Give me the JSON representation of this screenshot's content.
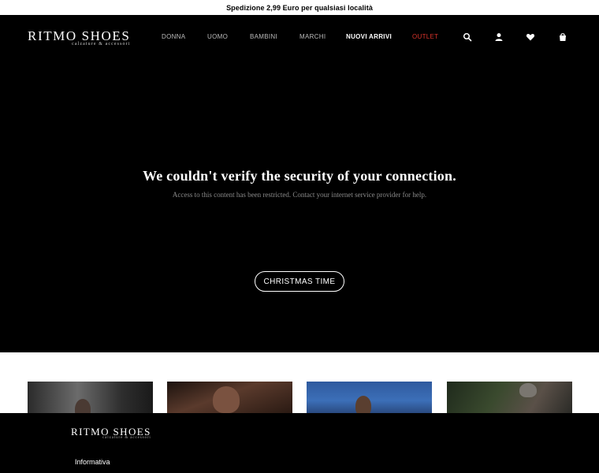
{
  "promo_bar": {
    "text": "Spedizione 2,99 Euro per qualsiasi località"
  },
  "brand": {
    "name": "RITMO SHOES",
    "tagline": "calzature & accessori"
  },
  "nav": {
    "items": [
      {
        "label": "DONNA"
      },
      {
        "label": "UOMO"
      },
      {
        "label": "BAMBINI"
      },
      {
        "label": "MARCHI"
      },
      {
        "label": "NUOVI ARRIVI"
      },
      {
        "label": "OUTLET"
      }
    ],
    "icons": [
      "search-icon",
      "user-icon",
      "heart-icon",
      "bag-icon"
    ]
  },
  "hero": {
    "title": "We couldn't verify the security of your connection.",
    "message": "Access to this content has been restricted. Contact your internet service provider for help.",
    "cta_label": "CHRISTMAS TIME"
  },
  "footer": {
    "brand": "RITMO SHOES",
    "tagline": "calzature & accessori",
    "link": "Informativa"
  },
  "colors": {
    "background": "#000000",
    "outlet": "#d9332b",
    "text": "#ffffff"
  }
}
